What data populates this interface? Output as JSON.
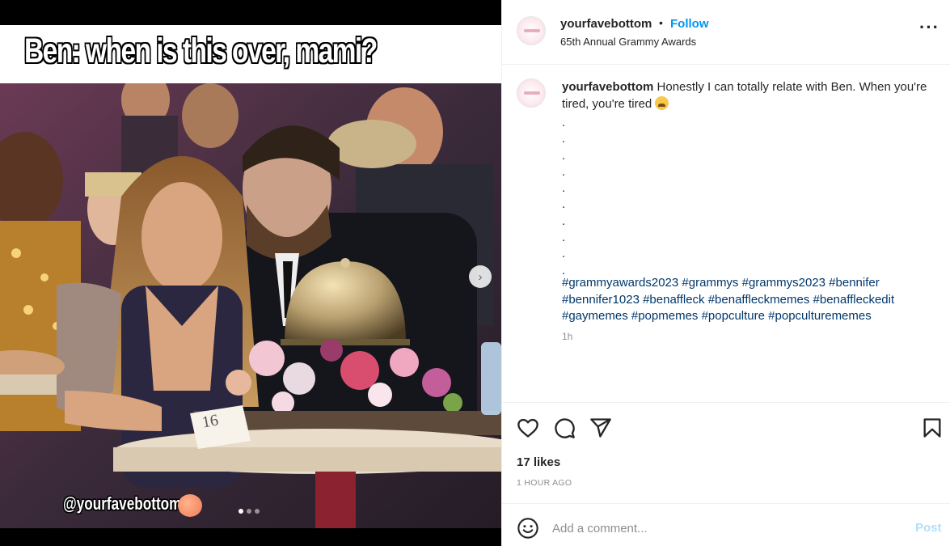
{
  "media": {
    "meme_caption": "Ben: when is this over, mami?",
    "watermark": "@yourfavebottom",
    "table_card": "16",
    "carousel_count": 3,
    "carousel_active": 0
  },
  "header": {
    "username": "yourfavebottom",
    "separator": "•",
    "follow_label": "Follow",
    "location": "65th Annual Grammy Awards",
    "more_icon": "more-horizontal-icon"
  },
  "caption": {
    "username": "yourfavebottom",
    "text": "Honestly I can totally relate with Ben. When you're tired, you're tired",
    "emoji": "tired-face-emoji",
    "dot_lines": [
      ".",
      ".",
      ".",
      ".",
      ".",
      ".",
      ".",
      ".",
      ".",
      "."
    ],
    "hashtags": [
      "#grammyawards2023",
      "#grammys",
      "#grammys2023",
      "#bennifer",
      "#bennifer1023",
      "#benaffleck",
      "#benaffleckmemes",
      "#benaffleckedit",
      "#gaymemes",
      "#popmemes",
      "#popculture",
      "#popculturememes"
    ],
    "time": "1h"
  },
  "actions": {
    "icons": [
      "heart-icon",
      "comment-icon",
      "share-icon",
      "bookmark-icon"
    ],
    "likes": "17 likes",
    "posted": "1 HOUR AGO"
  },
  "comment": {
    "placeholder": "Add a comment...",
    "post_label": "Post"
  },
  "colors": {
    "accent": "#0095f6",
    "hashtag": "#00376b",
    "muted": "#8e8e8e",
    "post_disabled": "#b2dffc"
  }
}
